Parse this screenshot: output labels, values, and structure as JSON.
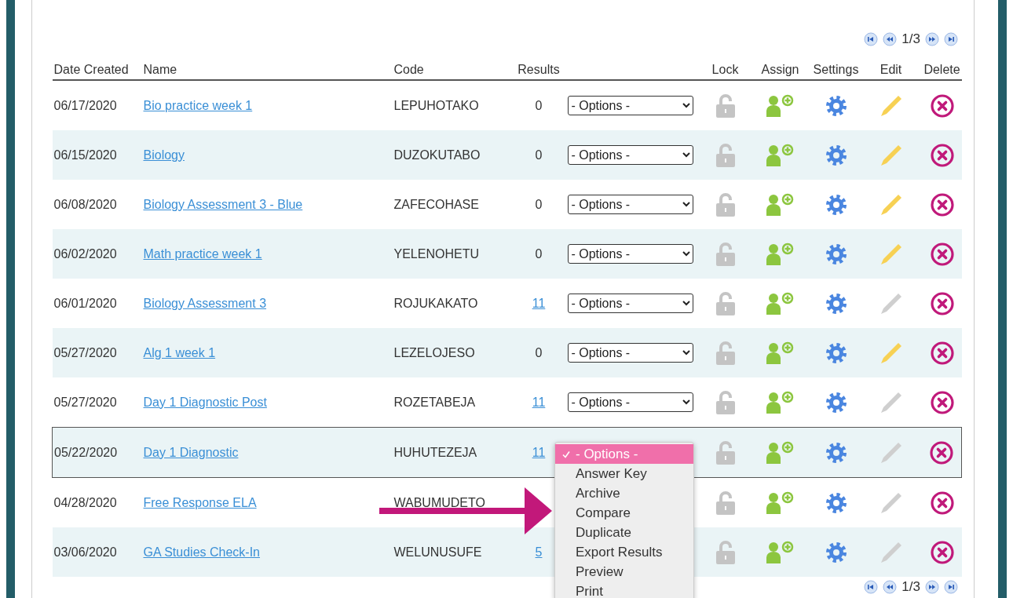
{
  "pagination_top": {
    "page": "1/3"
  },
  "columns": [
    "Date Created",
    "Name",
    "Code",
    "Results",
    "",
    "Lock",
    "Assign",
    "Settings",
    "Edit",
    "Delete"
  ],
  "rows": [
    {
      "date": "06/17/2020",
      "name": "Bio practice week 1",
      "code": "LEPUHOTAKO",
      "results": "0",
      "results_link": false,
      "options": "- Options -",
      "edit_enabled": true,
      "selected": false
    },
    {
      "date": "06/15/2020",
      "name": "Biology",
      "code": "DUZOKUTABO",
      "results": "0",
      "results_link": false,
      "options": "- Options -",
      "edit_enabled": true,
      "selected": false
    },
    {
      "date": "06/08/2020",
      "name": "Biology Assessment 3 - Blue",
      "code": "ZAFECOHASE",
      "results": "0",
      "results_link": false,
      "options": "- Options -",
      "edit_enabled": true,
      "selected": false
    },
    {
      "date": "06/02/2020",
      "name": "Math practice week 1",
      "code": "YELENOHETU",
      "results": "0",
      "results_link": false,
      "options": "- Options -",
      "edit_enabled": true,
      "selected": false
    },
    {
      "date": "06/01/2020",
      "name": "Biology Assessment 3",
      "code": "ROJUKAKATO",
      "results": "11",
      "results_link": true,
      "options": "- Options -",
      "edit_enabled": false,
      "selected": false
    },
    {
      "date": "05/27/2020",
      "name": "Alg 1 week 1",
      "code": "LEZELOJESO",
      "results": "0",
      "results_link": false,
      "options": "- Options -",
      "edit_enabled": true,
      "selected": false
    },
    {
      "date": "05/27/2020",
      "name": "Day 1 Diagnostic Post",
      "code": "ROZETABEJA",
      "results": "11",
      "results_link": true,
      "options": "- Options -",
      "edit_enabled": false,
      "selected": false
    },
    {
      "date": "05/22/2020",
      "name": "Day 1 Diagnostic",
      "code": "HUHUTEZEJA",
      "results": "11",
      "results_link": true,
      "edit_enabled": false,
      "selected": true
    },
    {
      "date": "04/28/2020",
      "name": "Free Response ELA",
      "code": "WABUMUDETO",
      "edit_enabled": false,
      "selected": false
    },
    {
      "date": "03/06/2020",
      "name": "GA Studies Check-In",
      "code": "WELUNUSUFE",
      "results": "5",
      "results_link": true,
      "edit_enabled": false,
      "selected": false
    }
  ],
  "options_menu": {
    "items": [
      {
        "label": "- Options -",
        "selected": true
      },
      {
        "label": "Answer Key",
        "selected": false
      },
      {
        "label": "Archive",
        "selected": false
      },
      {
        "label": "Compare",
        "selected": false
      },
      {
        "label": "Duplicate",
        "selected": false
      },
      {
        "label": "Export Results",
        "selected": false
      },
      {
        "label": "Preview",
        "selected": false
      },
      {
        "label": "Print",
        "selected": false
      }
    ]
  },
  "pagination_bottom": {
    "page": "1/3"
  }
}
